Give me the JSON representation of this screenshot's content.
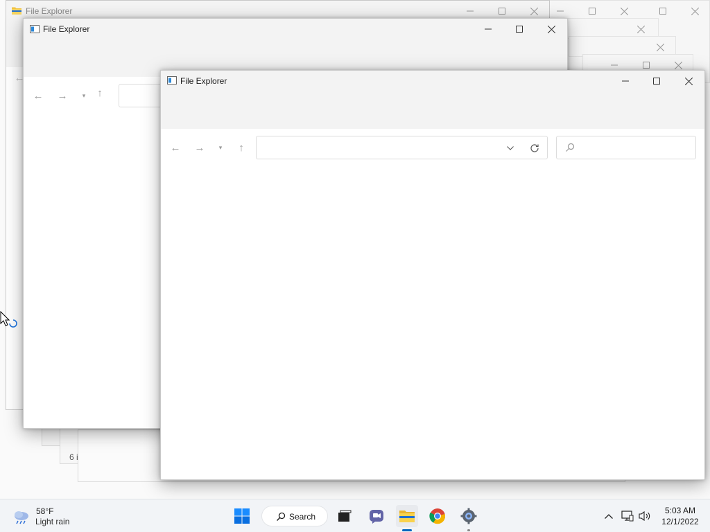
{
  "windows": {
    "back": {
      "title": "File Explorer"
    },
    "middle": {
      "title": "File Explorer"
    },
    "front": {
      "title": "File Explorer",
      "address": {
        "value": "",
        "placeholder": ""
      },
      "search": {
        "value": "",
        "placeholder": ""
      }
    },
    "ghost_fragment": "6 i"
  },
  "taskbar": {
    "weather": {
      "temp": "58°F",
      "condition": "Light rain"
    },
    "search_label": "Search",
    "clock": {
      "time": "5:03 AM",
      "date": "12/1/2022"
    }
  },
  "colors": {
    "accent": "#0067c0",
    "taskbar_bg": "#f2f4f7",
    "window_chrome": "#f3f3f3"
  },
  "icons": {
    "start": "windows-start-icon",
    "search": "search-icon",
    "task_view": "task-view-icon",
    "chat": "teams-chat-icon",
    "file_explorer": "folder-icon",
    "chrome": "chrome-icon",
    "settings": "gear-icon"
  }
}
